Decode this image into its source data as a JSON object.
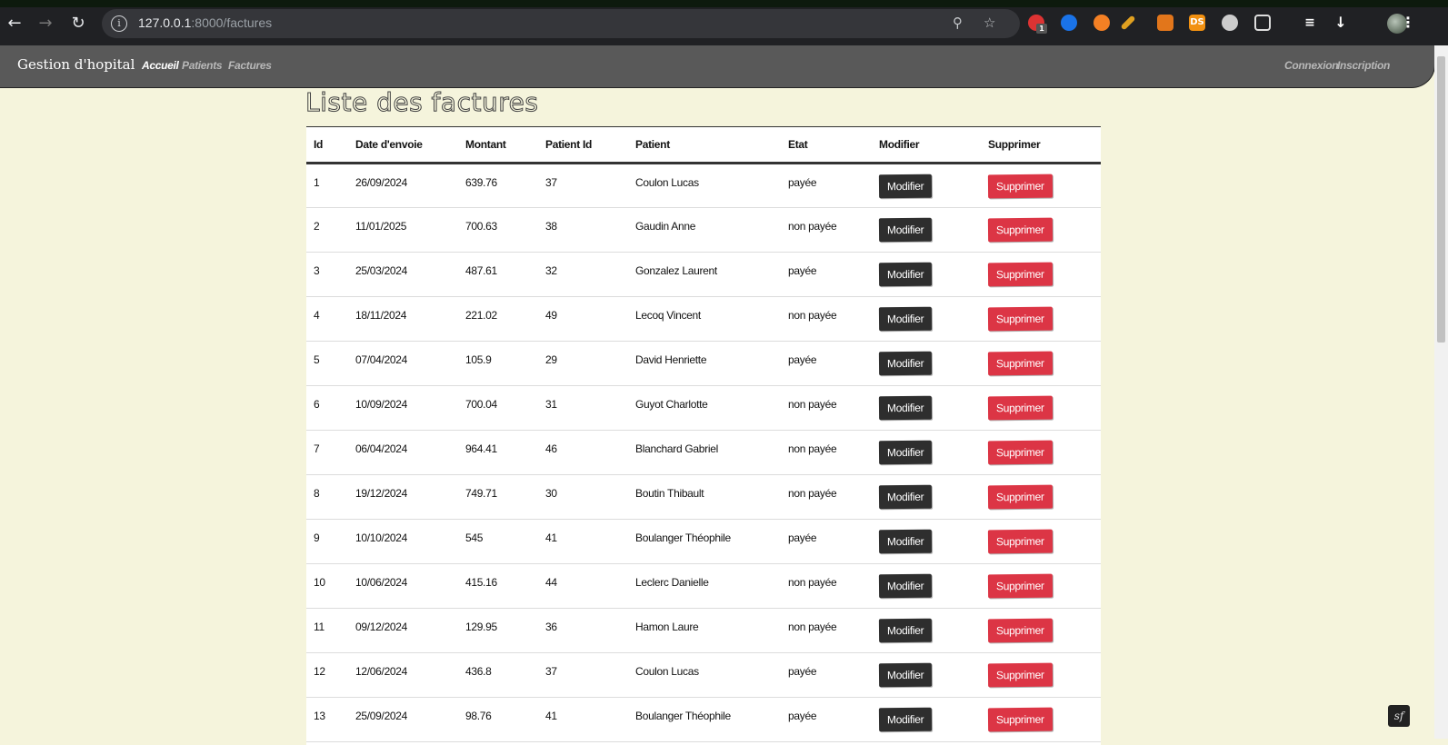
{
  "browser": {
    "url_host": "127.0.0.1",
    "url_rest": ":8000/factures",
    "extension_badge": "1",
    "ext_ds_label": "DS"
  },
  "navbar": {
    "brand": "Gestion d'hopital",
    "links": [
      "Accueil",
      "Patients",
      "Factures"
    ],
    "right_links": [
      "Connexion",
      "Inscription"
    ]
  },
  "page": {
    "title": "Liste des factures"
  },
  "table": {
    "headers": [
      "Id",
      "Date d'envoie",
      "Montant",
      "Patient Id",
      "Patient",
      "Etat",
      "Modifier",
      "Supprimer"
    ],
    "edit_label": "Modifier",
    "delete_label": "Supprimer",
    "rows": [
      [
        "1",
        "26/09/2024",
        "639.76",
        "37",
        "Coulon Lucas",
        "payée"
      ],
      [
        "2",
        "11/01/2025",
        "700.63",
        "38",
        "Gaudin Anne",
        "non payée"
      ],
      [
        "3",
        "25/03/2024",
        "487.61",
        "32",
        "Gonzalez Laurent",
        "payée"
      ],
      [
        "4",
        "18/11/2024",
        "221.02",
        "49",
        "Lecoq Vincent",
        "non payée"
      ],
      [
        "5",
        "07/04/2024",
        "105.9",
        "29",
        "David Henriette",
        "payée"
      ],
      [
        "6",
        "10/09/2024",
        "700.04",
        "31",
        "Guyot Charlotte",
        "non payée"
      ],
      [
        "7",
        "06/04/2024",
        "964.41",
        "46",
        "Blanchard Gabriel",
        "non payée"
      ],
      [
        "8",
        "19/12/2024",
        "749.71",
        "30",
        "Boutin Thibault",
        "non payée"
      ],
      [
        "9",
        "10/10/2024",
        "545",
        "41",
        "Boulanger Théophile",
        "payée"
      ],
      [
        "10",
        "10/06/2024",
        "415.16",
        "44",
        "Leclerc Danielle",
        "non payée"
      ],
      [
        "11",
        "09/12/2024",
        "129.95",
        "36",
        "Hamon Laure",
        "non payée"
      ],
      [
        "12",
        "12/06/2024",
        "436.8",
        "37",
        "Coulon Lucas",
        "payée"
      ],
      [
        "13",
        "25/09/2024",
        "98.76",
        "41",
        "Boulanger Théophile",
        "payée"
      ]
    ]
  },
  "colors": {
    "page_bg": "#f5f4dc",
    "navbar_bg": "#595959",
    "edit_button": "#2e2e2e",
    "delete_button": "#dc3545"
  }
}
